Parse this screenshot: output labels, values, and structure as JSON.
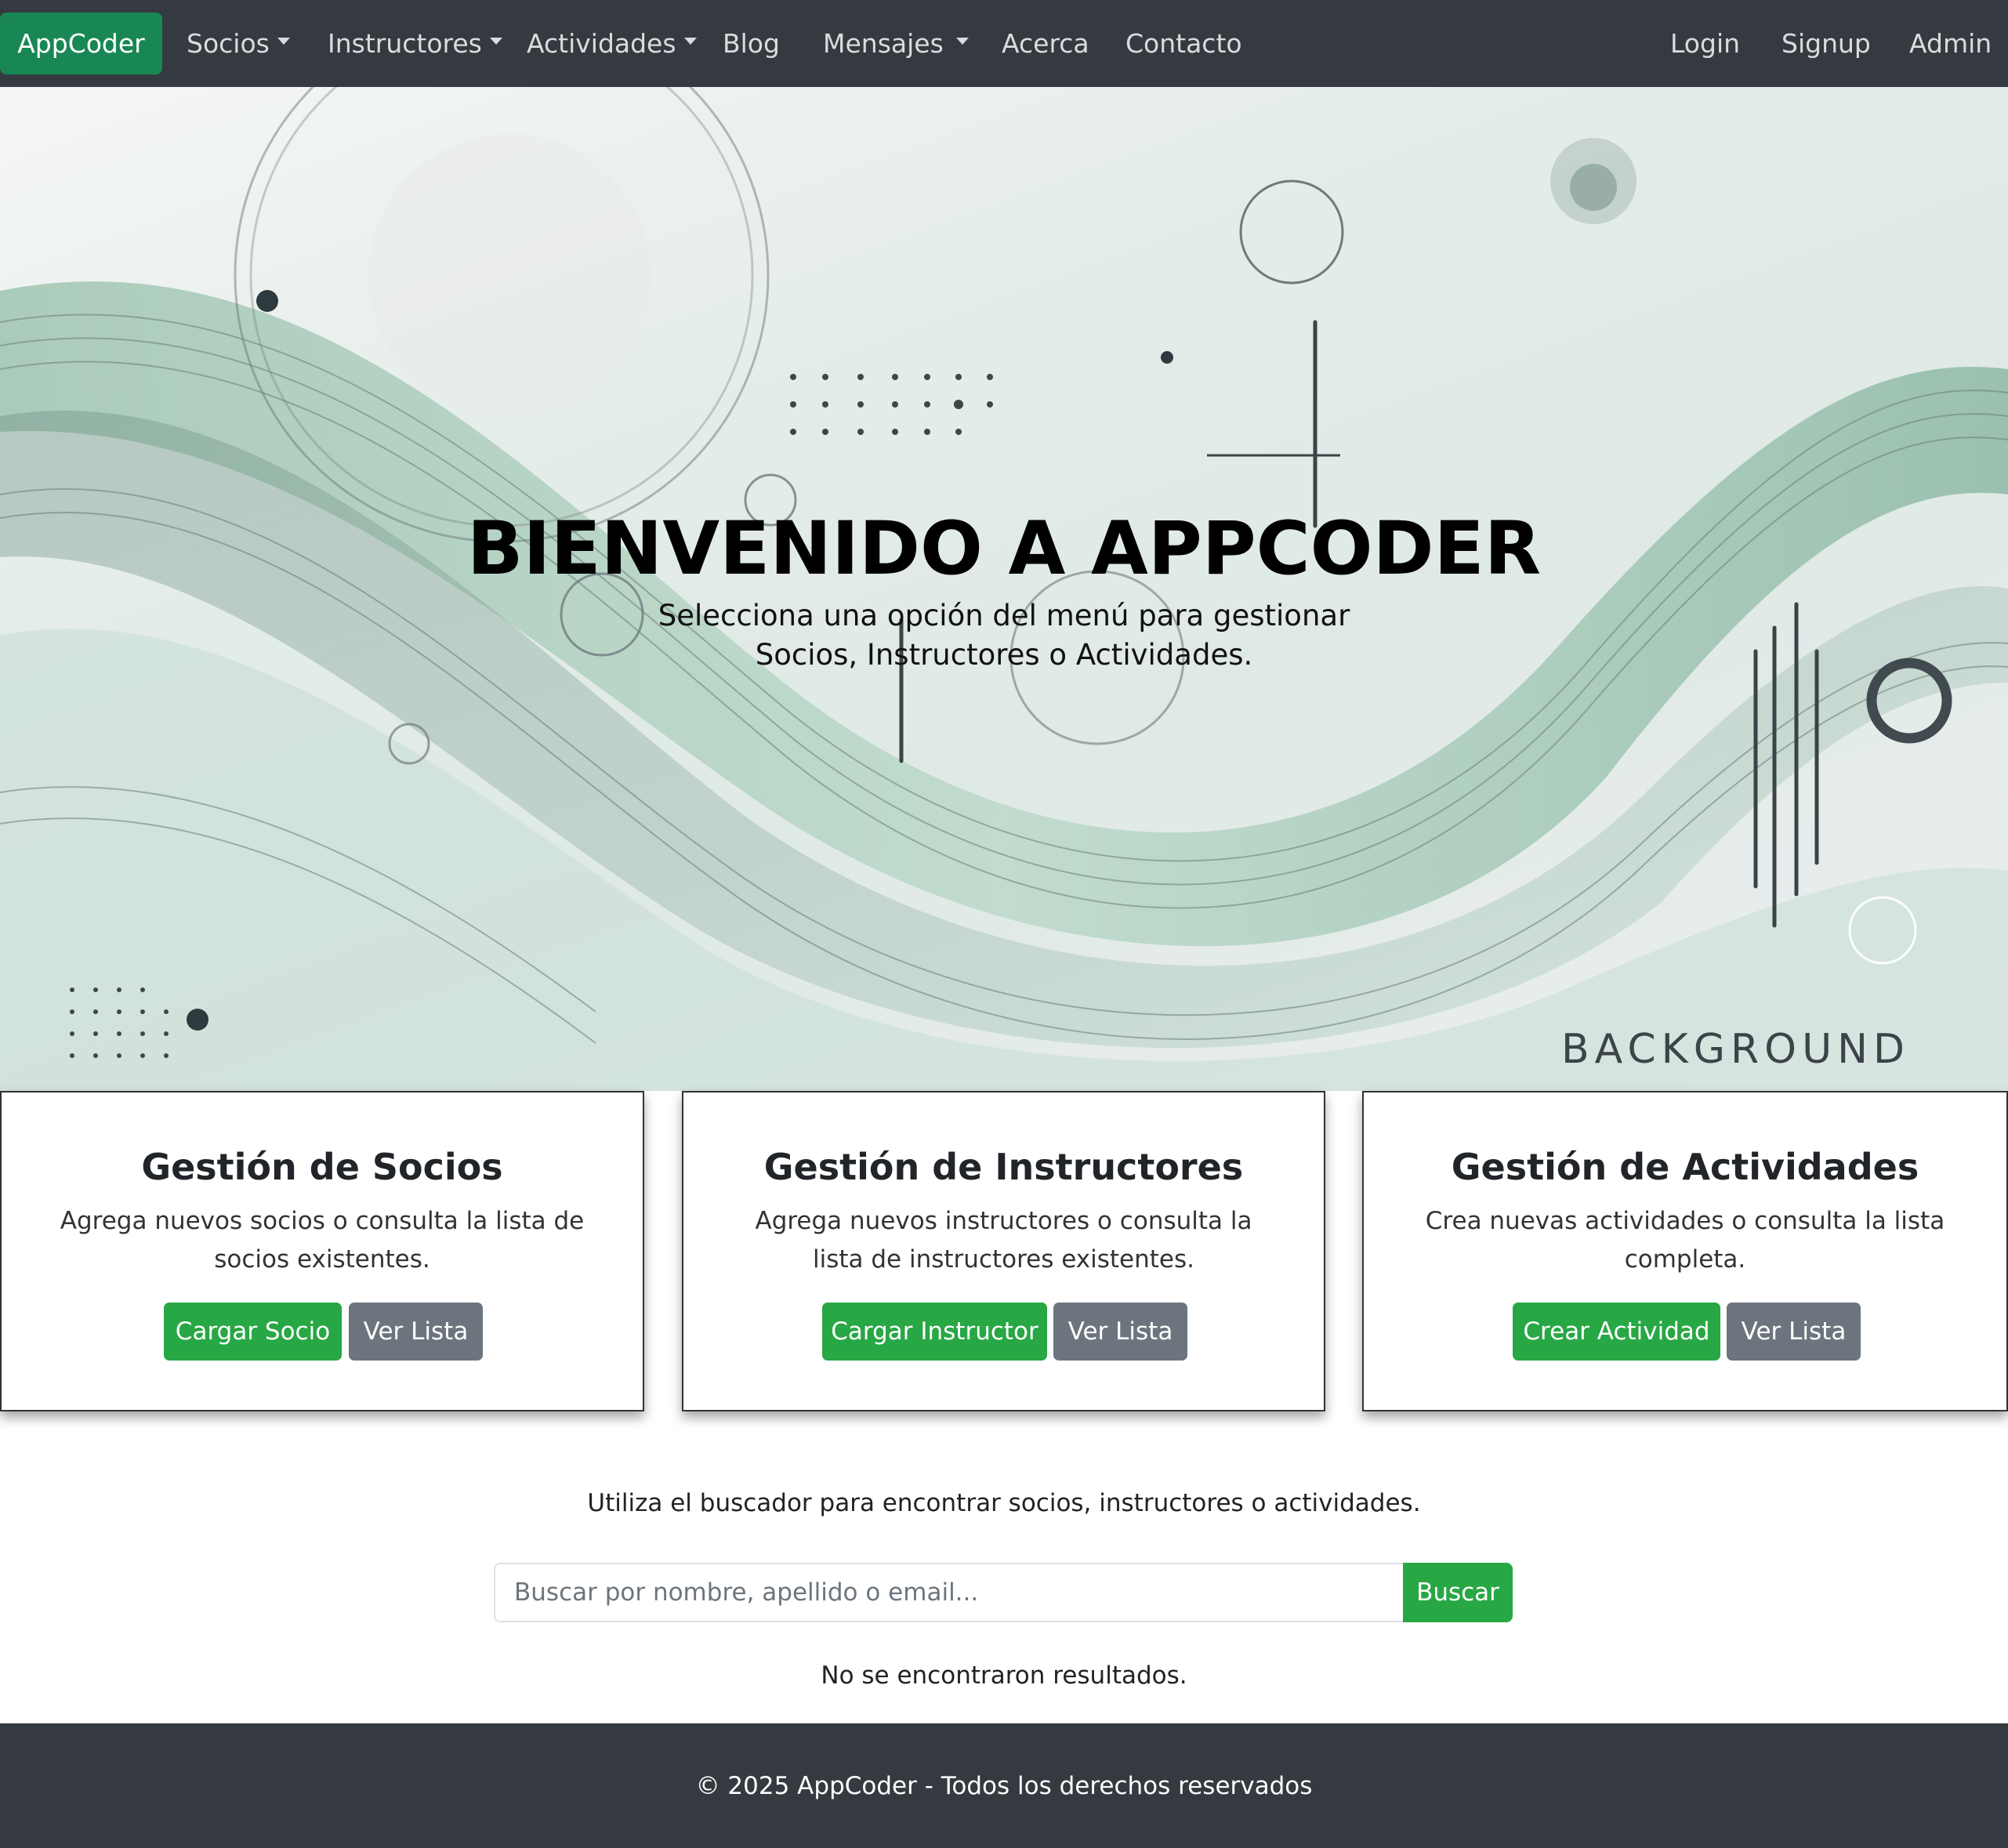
{
  "navbar": {
    "brand": "AppCoder",
    "items": [
      {
        "label": "Socios",
        "dropdown": true
      },
      {
        "label": "Instructores",
        "dropdown": true
      },
      {
        "label": "Actividades",
        "dropdown": true
      },
      {
        "label": "Blog",
        "dropdown": false
      },
      {
        "label": "Mensajes",
        "dropdown": true
      },
      {
        "label": "Acerca",
        "dropdown": false
      },
      {
        "label": "Contacto",
        "dropdown": false
      }
    ],
    "right_items": [
      {
        "label": "Login"
      },
      {
        "label": "Signup"
      },
      {
        "label": "Admin"
      }
    ]
  },
  "hero": {
    "title": "BIENVENIDO A APPCODER",
    "subtitle_line1": "Selecciona una opción del menú para gestionar",
    "subtitle_line2": "Socios, Instructores o Actividades.",
    "background_text": "BACKGROUND"
  },
  "cards": [
    {
      "title": "Gestión de Socios",
      "description": "Agrega nuevos socios o consulta la lista de socios existentes.",
      "primary_button": "Cargar Socio",
      "secondary_button": "Ver Lista"
    },
    {
      "title": "Gestión de Instructores",
      "description": "Agrega nuevos instructores o consulta la lista de instructores existentes.",
      "primary_button": "Cargar Instructor",
      "secondary_button": "Ver Lista"
    },
    {
      "title": "Gestión de Actividades",
      "description": "Crea nuevas actividades o consulta la lista completa.",
      "primary_button": "Crear Actividad",
      "secondary_button": "Ver Lista"
    }
  ],
  "search": {
    "hint": "Utiliza el buscador para encontrar socios, instructores o actividades.",
    "placeholder": "Buscar por nombre, apellido o email...",
    "button": "Buscar",
    "no_results": "No se encontraron resultados."
  },
  "footer": {
    "text": "© 2025 AppCoder - Todos los derechos reservados"
  },
  "colors": {
    "navbar_bg": "#343a40",
    "brand_bg": "#198754",
    "primary_button": "#28a745",
    "secondary_button": "#6c757d"
  }
}
